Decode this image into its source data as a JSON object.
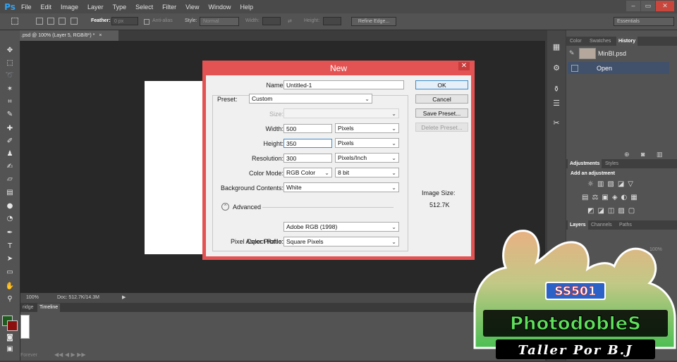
{
  "app": {
    "logo": "Ps"
  },
  "menu": [
    "File",
    "Edit",
    "Image",
    "Layer",
    "Type",
    "Select",
    "Filter",
    "View",
    "Window",
    "Help"
  ],
  "window_controls": {
    "minimize": "–",
    "restore": "▭",
    "close": "✕"
  },
  "options_bar": {
    "feather_label": "Feather:",
    "feather_value": "0 px",
    "antialias_label": "Anti-alias",
    "style_label": "Style:",
    "style_value": "Normal",
    "width_label": "Width:",
    "height_label": "Height:",
    "refine_edge": "Refine Edge...",
    "workspace": "Essentials"
  },
  "document_tab": ".psd @ 100% (Layer 5, RGB/8*) *",
  "status_bar": {
    "zoom": "100%",
    "doc": "Doc: 512.7K/14.3M"
  },
  "timeline": {
    "tabs": [
      "ridge",
      "Timeline"
    ],
    "forever": "Forever"
  },
  "right_panel": {
    "top_tabs": [
      "Color",
      "Swatches",
      "History"
    ],
    "history_items": [
      "MinBI.psd",
      "Open"
    ],
    "adj_tabs": [
      "Adjustments",
      "Styles"
    ],
    "add_adjustment": "Add an adjustment",
    "layers_tabs": [
      "Layers",
      "Channels",
      "Paths"
    ],
    "opacity": "100%"
  },
  "dialog": {
    "title": "New",
    "name_label": "Name:",
    "name_value": "Untitled-1",
    "preset_label": "Preset:",
    "preset_value": "Custom",
    "size_label": "Size:",
    "width_label": "Width:",
    "width_value": "500",
    "width_unit": "Pixels",
    "height_label": "Height:",
    "height_value": "350",
    "height_unit": "Pixels",
    "resolution_label": "Resolution:",
    "resolution_value": "300",
    "resolution_unit": "Pixels/Inch",
    "color_mode_label": "Color Mode:",
    "color_mode_value": "RGB Color",
    "bit_depth": "8 bit",
    "bg_label": "Background Contents:",
    "bg_value": "White",
    "advanced_label": "Advanced",
    "color_profile_label": "Color Profile:",
    "color_profile_value": "Adobe RGB (1998)",
    "pixel_aspect_label": "Pixel Aspect Ratio:",
    "pixel_aspect_value": "Square Pixels",
    "ok": "OK",
    "cancel": "Cancel",
    "save_preset": "Save Preset...",
    "delete_preset": "Delete Preset...",
    "image_size_label": "Image Size:",
    "image_size_value": "512.7K"
  },
  "watermark": {
    "badge": "SS501",
    "title": "PhotodobleS",
    "subtitle": "Taller Por B.J"
  },
  "colors": {
    "accent": "#e45353",
    "canvas": "#282828",
    "panel": "#535353",
    "history_selected": "#41506b",
    "foreground": "#1f5a1f",
    "background": "#8b0f0f"
  }
}
